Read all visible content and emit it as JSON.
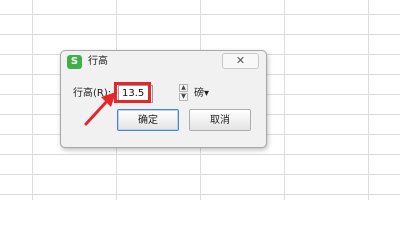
{
  "dialog": {
    "title": "行高",
    "app_icon_glyph": "S",
    "close_label": "✕",
    "row_height_label": "行高(R):",
    "row_height_value": "13.5",
    "unit_label": "磅▾",
    "ok_label": "确定",
    "cancel_label": "取消"
  },
  "colors": {
    "app_icon": "#3eb049",
    "highlight": "#e8262a",
    "ok_border": "#4f83c9"
  },
  "icons": [
    "spin-up-icon",
    "spin-down-icon",
    "red-arrow-icon"
  ]
}
